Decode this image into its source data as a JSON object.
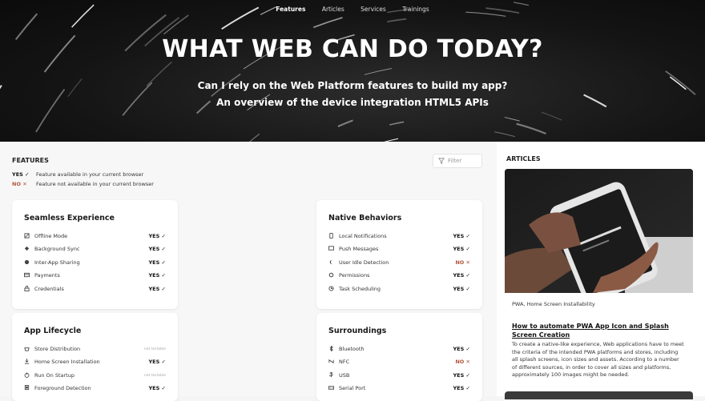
{
  "nav": {
    "items": [
      "Features",
      "Articles",
      "Services",
      "Trainings"
    ],
    "active": "Features"
  },
  "hero": {
    "title": "WHAT WEB CAN DO TODAY?",
    "line1": "Can I rely on the Web Platform features to build my app?",
    "line2": "An overview of the device integration HTML5 APIs"
  },
  "features": {
    "title": "FEATURES",
    "filter_placeholder": "Filter",
    "legend": [
      {
        "mark": "YES ✓",
        "text": "Feature available in your current browser"
      },
      {
        "mark": "NO ✕",
        "text": "Feature not available in your current browser"
      }
    ],
    "cards": [
      {
        "title": "Seamless Experience",
        "items": [
          {
            "icon": "offline-icon",
            "label": "Offline Mode",
            "status": "YES ✓"
          },
          {
            "icon": "sync-icon",
            "label": "Background Sync",
            "status": "YES ✓"
          },
          {
            "icon": "share-icon",
            "label": "Inter-App Sharing",
            "status": "YES ✓"
          },
          {
            "icon": "card-icon",
            "label": "Payments",
            "status": "YES ✓"
          },
          {
            "icon": "lock-icon",
            "label": "Credentials",
            "status": "YES ✓"
          }
        ]
      },
      {
        "title": "Native Behaviors",
        "items": [
          {
            "icon": "phone-icon",
            "label": "Local Notifications",
            "status": "YES ✓"
          },
          {
            "icon": "message-icon",
            "label": "Push Messages",
            "status": "YES ✓"
          },
          {
            "icon": "moon-icon",
            "label": "User Idle Detection",
            "status": "NO ✕"
          },
          {
            "icon": "gear-icon",
            "label": "Permissions",
            "status": "YES ✓"
          },
          {
            "icon": "clock-icon",
            "label": "Task Scheduling",
            "status": "YES ✓"
          }
        ]
      },
      {
        "title": "App Lifecycle",
        "items": [
          {
            "icon": "store-icon",
            "label": "Store Distribution",
            "status": "not testable"
          },
          {
            "icon": "download-icon",
            "label": "Home Screen Installation",
            "status": "YES ✓"
          },
          {
            "icon": "power-icon",
            "label": "Run On Startup",
            "status": "not testable"
          },
          {
            "icon": "foreground-icon",
            "label": "Foreground Detection",
            "status": "YES ✓"
          }
        ]
      },
      {
        "title": "Surroundings",
        "items": [
          {
            "icon": "bluetooth-icon",
            "label": "Bluetooth",
            "status": "YES ✓"
          },
          {
            "icon": "nfc-icon",
            "label": "NFC",
            "status": "NO ✕"
          },
          {
            "icon": "usb-icon",
            "label": "USB",
            "status": "YES ✓"
          },
          {
            "icon": "serial-icon",
            "label": "Serial Port",
            "status": "YES ✓"
          }
        ]
      }
    ]
  },
  "articles": {
    "title": "ARTICLES",
    "category": "PWA, Home Screen Installability",
    "headline": "How to automate PWA App Icon and Splash Screen Creation",
    "excerpt": "To create a native-like experience, Web applications have to meet the criteria of the intended PWA platforms and stores, including all splash screens, icon sizes and assets. According to a number of different sources, in order to cover all sizes and platforms, approximately 100 images might be needed."
  }
}
